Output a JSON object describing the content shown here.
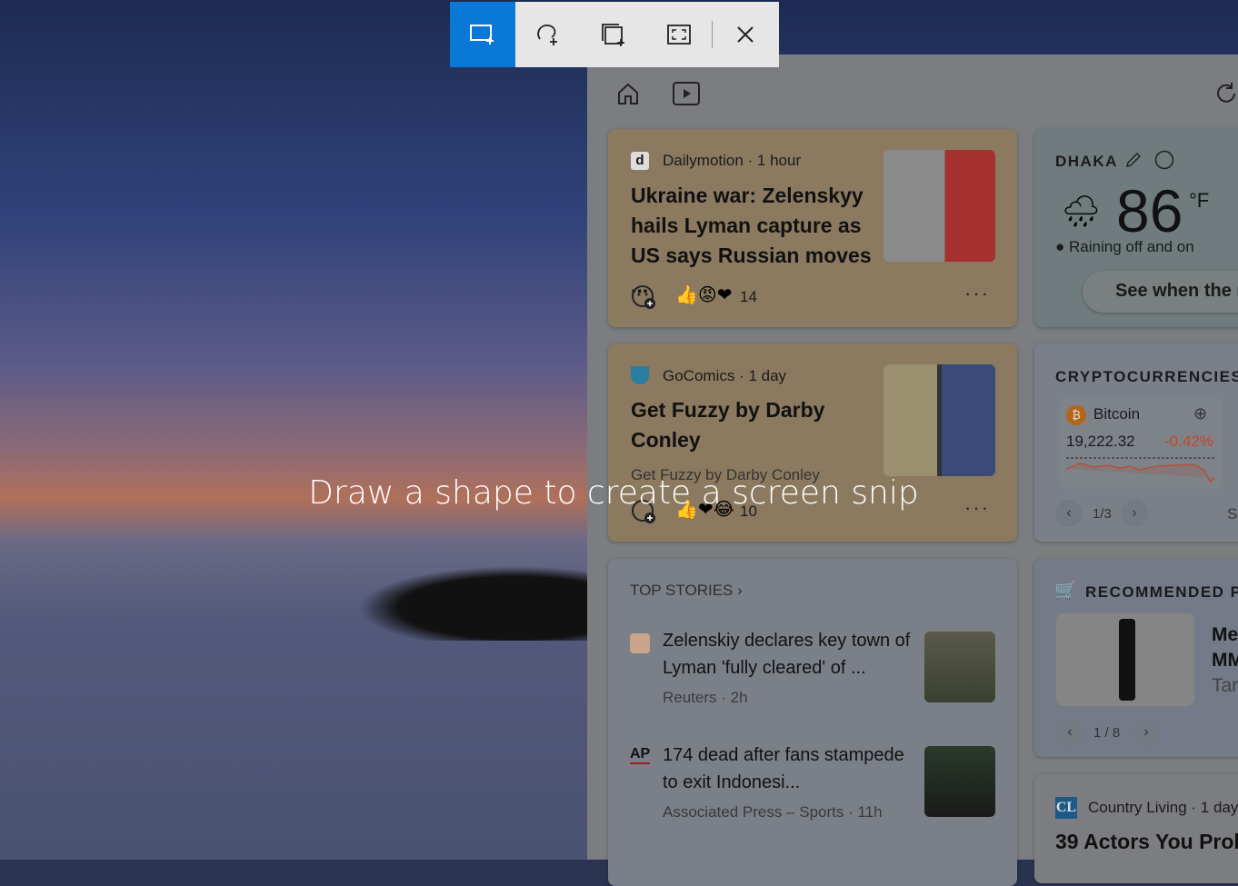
{
  "toolbar": {
    "tools": [
      "rectangular-snip",
      "freeform-snip",
      "window-snip",
      "fullscreen-snip"
    ],
    "close": "close"
  },
  "hint": "Draw a shape to create a screen snip",
  "feed": {
    "card1": {
      "source": "Dailymotion · 1 hour",
      "title": "Ukraine war: Zelenskyy hails Lyman capture as US says Russian moves ...",
      "reactions": "14"
    },
    "card2": {
      "source": "GoComics · 1 day",
      "title": "Get Fuzzy by Darby Conley",
      "subtitle": "Get Fuzzy by Darby Conley",
      "reactions": "10"
    },
    "top_stories": {
      "header": "TOP STORIES",
      "items": [
        {
          "title": "Zelenskiy declares key town of Lyman 'fully cleared' of ...",
          "meta": "Reuters · 2h",
          "logo": ""
        },
        {
          "title": "174 dead after fans stampede to exit Indonesi...",
          "meta": "Associated Press – Sports · 11h",
          "logo": "AP"
        }
      ]
    }
  },
  "weather": {
    "city": "DHAKA",
    "temp": "86",
    "unit": "°F",
    "condition": "Raining off and on",
    "button": "See when the r"
  },
  "crypto": {
    "header": "CRYPTOCURRENCIES",
    "name": "Bitcoin",
    "price": "19,222.32",
    "change": "-0.42%",
    "pager": "1/3",
    "next_peek": "S"
  },
  "recommended": {
    "header": "RECOMMENDED PI",
    "title1": "Me",
    "title2": "MM",
    "store": "Tar",
    "pager": "1 / 8"
  },
  "country": {
    "logo": "CL",
    "source": "Country Living · 1 day",
    "title": "39 Actors You Prob"
  },
  "colors": {
    "accent": "#0a78d7",
    "negative": "#c0492a"
  }
}
